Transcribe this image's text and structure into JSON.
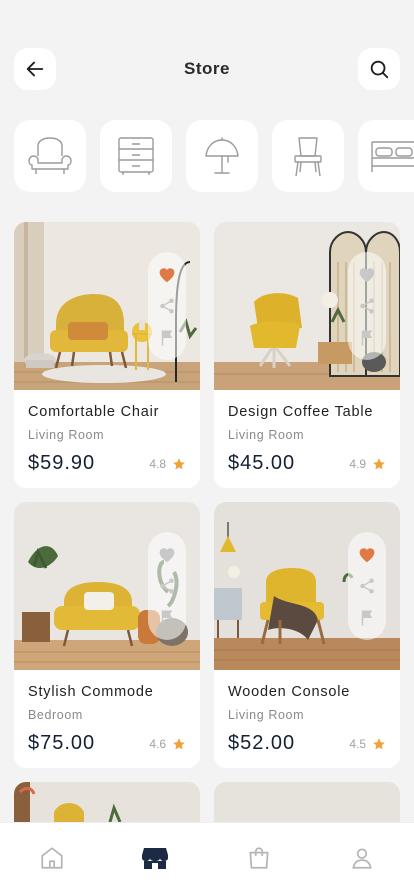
{
  "header": {
    "title": "Store",
    "back_icon": "arrow-left-icon",
    "search_icon": "search-icon"
  },
  "categories": [
    {
      "icon": "armchair-icon"
    },
    {
      "icon": "drawer-cabinet-icon"
    },
    {
      "icon": "table-lamp-icon"
    },
    {
      "icon": "dining-chair-icon"
    },
    {
      "icon": "bed-icon"
    }
  ],
  "products": [
    {
      "name": "Comfortable Chair",
      "room": "Living Room",
      "price": "$59.90",
      "rating": "4.8",
      "favorited": true
    },
    {
      "name": "Design Coffee Table",
      "room": "Living Room",
      "price": "$45.00",
      "rating": "4.9",
      "favorited": false
    },
    {
      "name": "Stylish Commode",
      "room": "Bedroom",
      "price": "$75.00",
      "rating": "4.6",
      "favorited": false
    },
    {
      "name": "Wooden Console",
      "room": "Living Room",
      "price": "$52.00",
      "rating": "4.5",
      "favorited": true
    }
  ],
  "colors": {
    "accent": "#e07a45",
    "star": "#f0a23a",
    "price": "#152035",
    "muted_icon": "#c8c8c8"
  },
  "tabbar": [
    {
      "icon": "home-icon",
      "active": false
    },
    {
      "icon": "store-icon",
      "active": true
    },
    {
      "icon": "shopping-bag-icon",
      "active": false
    },
    {
      "icon": "profile-icon",
      "active": false
    }
  ]
}
